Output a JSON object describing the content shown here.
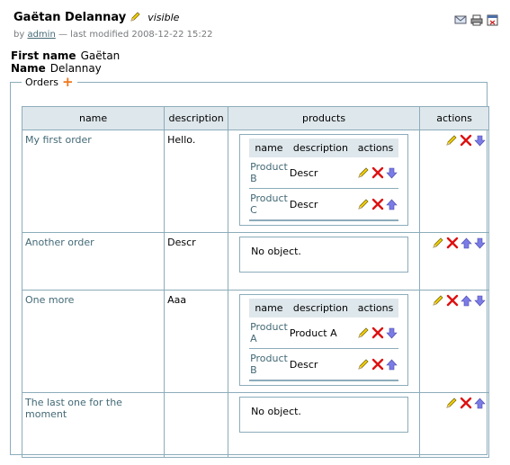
{
  "page": {
    "title": "Gaëtan Delannay",
    "state": "visible",
    "byline_prefix": "by",
    "author": "admin",
    "byline_suffix": "— last modified 2008-12-22 15:22"
  },
  "fields": [
    {
      "label": "First name",
      "value": "Gaëtan"
    },
    {
      "label": "Name",
      "value": "Delannay"
    }
  ],
  "orders_legend": "Orders",
  "orders_headers": {
    "name": "name",
    "description": "description",
    "products": "products",
    "actions": "actions"
  },
  "products_headers": {
    "name": "name",
    "description": "description",
    "actions": "actions"
  },
  "no_object": "No object.",
  "orders": [
    {
      "name": "My first order",
      "description": "Hello.",
      "products": [
        {
          "name": "Product B",
          "description": "Descr"
        },
        {
          "name": "Product C",
          "description": "Descr"
        }
      ]
    },
    {
      "name": "Another order",
      "description": "Descr",
      "products": []
    },
    {
      "name": "One more",
      "description": "Aaa",
      "products": [
        {
          "name": "Product A",
          "description": "Product A"
        },
        {
          "name": "Product B",
          "description": "Descr"
        }
      ]
    },
    {
      "name": "The last one for the moment",
      "description": "",
      "products": []
    }
  ],
  "colors": {
    "link": "#436976",
    "border": "#8cacbb",
    "header_bg": "#dee7ec",
    "delete": "#d11",
    "arrow": "#6a6ae0"
  }
}
